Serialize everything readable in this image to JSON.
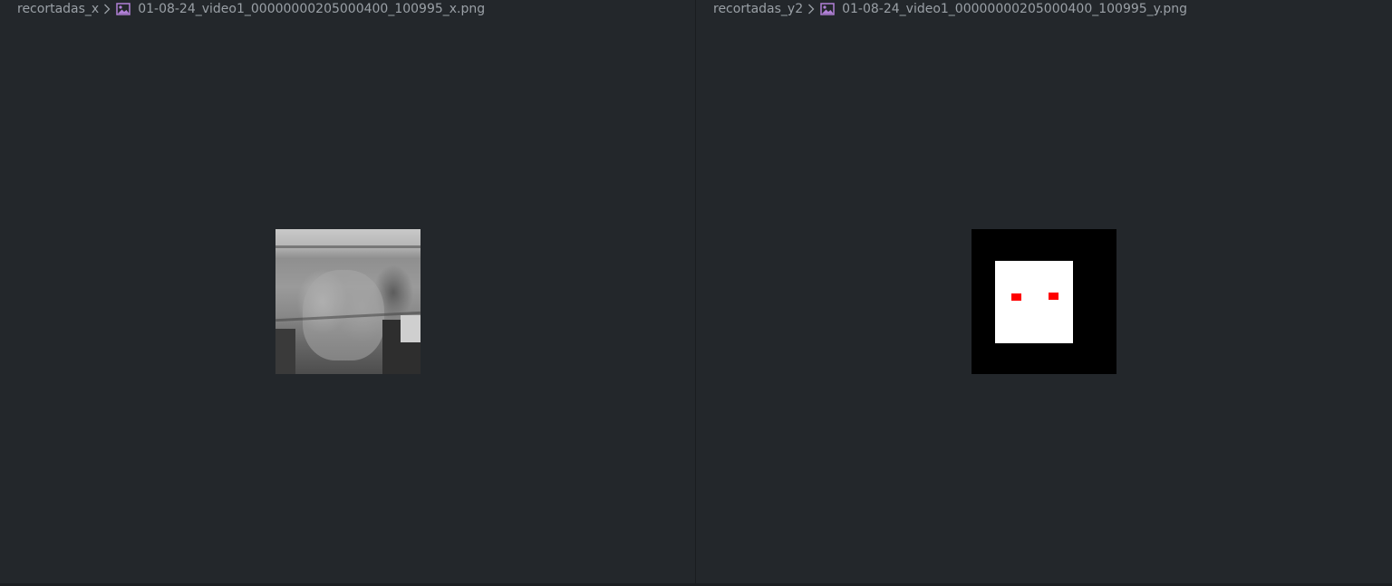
{
  "left_pane": {
    "folder": "recortadas_x",
    "file": "01-08-24_video1_00000000205000400_100995_x.png"
  },
  "right_pane": {
    "folder": "recortadas_y2",
    "file": "01-08-24_video1_00000000205000400_100995_y.png"
  },
  "icons": {
    "separator": "chevron-right-icon",
    "file": "image-file-icon"
  },
  "colors": {
    "background": "#23272b",
    "text": "#9aa0a6",
    "file_icon": "#b180d7",
    "mask_marker": "#ff0000"
  }
}
